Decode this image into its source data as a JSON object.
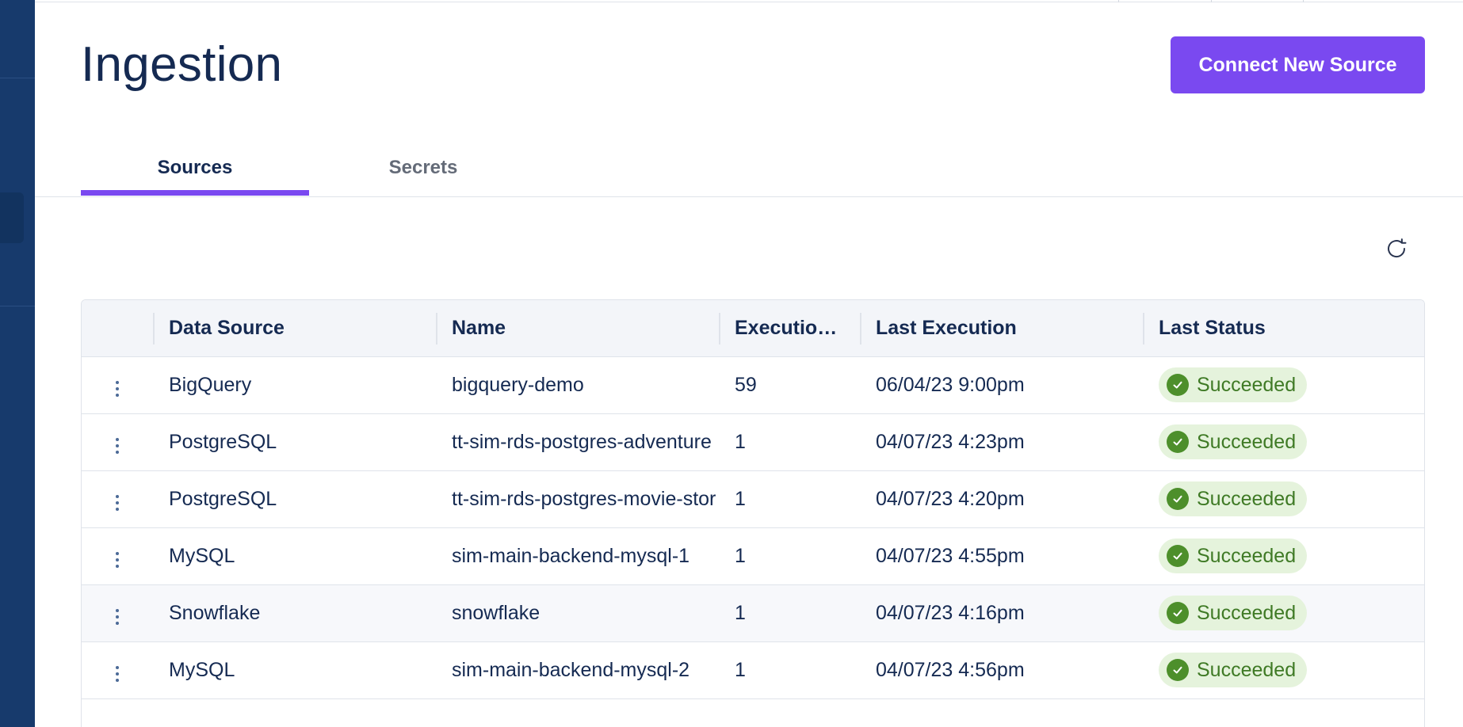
{
  "page": {
    "title": "Ingestion",
    "connect_button": "Connect New Source"
  },
  "tabs": [
    {
      "label": "Sources",
      "active": true
    },
    {
      "label": "Secrets",
      "active": false
    }
  ],
  "icons": {
    "refresh": "refresh-icon",
    "row_menu": "more-vertical-icon",
    "status_ok": "check-circle-icon"
  },
  "colors": {
    "accent": "#7a49f0",
    "sidebar": "#173a6c",
    "success_bg": "#e5f3dc",
    "success_fg": "#3f7a25"
  },
  "table": {
    "columns": [
      "Data Source",
      "Name",
      "Execution ...",
      "Last Execution",
      "Last Status"
    ],
    "rows": [
      {
        "source": "BigQuery",
        "name": "bigquery-demo",
        "executions": "59",
        "last_execution": "06/04/23 9:00pm",
        "status": "Succeeded"
      },
      {
        "source": "PostgreSQL",
        "name": "tt-sim-rds-postgres-adventure",
        "executions": "1",
        "last_execution": "04/07/23 4:23pm",
        "status": "Succeeded"
      },
      {
        "source": "PostgreSQL",
        "name": "tt-sim-rds-postgres-movie-stor",
        "executions": "1",
        "last_execution": "04/07/23 4:20pm",
        "status": "Succeeded"
      },
      {
        "source": "MySQL",
        "name": "sim-main-backend-mysql-1",
        "executions": "1",
        "last_execution": "04/07/23 4:55pm",
        "status": "Succeeded"
      },
      {
        "source": "Snowflake",
        "name": "snowflake",
        "executions": "1",
        "last_execution": "04/07/23 4:16pm",
        "status": "Succeeded"
      },
      {
        "source": "MySQL",
        "name": "sim-main-backend-mysql-2",
        "executions": "1",
        "last_execution": "04/07/23 4:56pm",
        "status": "Succeeded"
      }
    ]
  }
}
